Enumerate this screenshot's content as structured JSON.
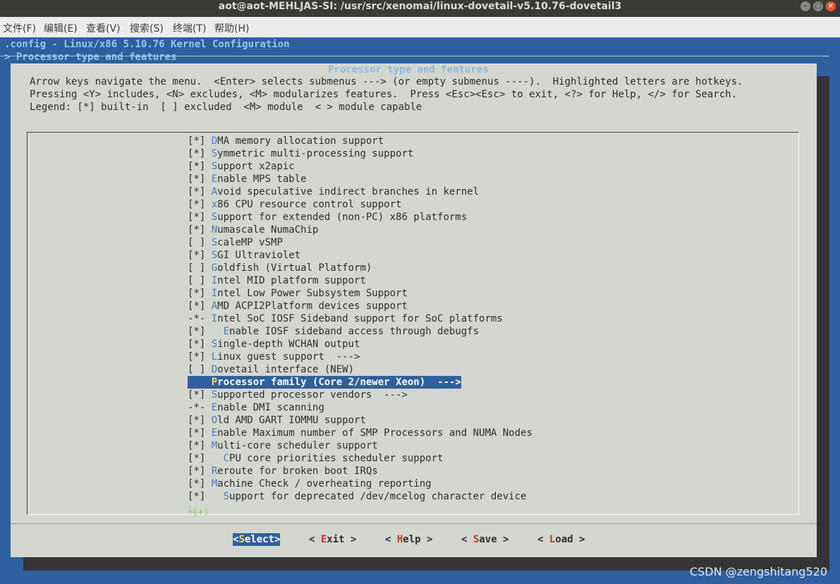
{
  "window": {
    "title": "aot@aot-MEHLJAS-SI: /usr/src/xenomai/linux-dovetail-v5.10.76-dovetail3",
    "buttons": [
      "–",
      "□",
      "×"
    ]
  },
  "menubar": [
    "文件(F)",
    "编辑(E)",
    "查看(V)",
    "搜索(S)",
    "终端(T)",
    "帮助(H)"
  ],
  "header": {
    "config_line": ".config - Linux/x86 5.10.76 Kernel Configuration",
    "breadcrumb": "> Processor type and features"
  },
  "dialog": {
    "title": "Processor type and features",
    "help_lines": [
      "Arrow keys navigate the menu.  <Enter> selects submenus ---> (or empty submenus ----).  Highlighted letters are hotkeys.",
      "Pressing <Y> includes, <N> excludes, <M> modularizes features.  Press <Esc><Esc> to exit, <?> for Help, </> for Search.",
      "Legend: [*] built-in  [ ] excluded  <M> module  < > module capable"
    ]
  },
  "items": [
    {
      "state": "[*]",
      "indent": "",
      "hotkey": "D",
      "rest": "MA memory allocation support"
    },
    {
      "state": "[*]",
      "indent": "",
      "hotkey": "S",
      "rest": "ymmetric multi-processing support"
    },
    {
      "state": "[*]",
      "indent": "",
      "hotkey": "S",
      "rest": "upport x2apic"
    },
    {
      "state": "[*]",
      "indent": "",
      "hotkey": "E",
      "rest": "nable MPS table"
    },
    {
      "state": "[*]",
      "indent": "",
      "hotkey": "A",
      "rest": "void speculative indirect branches in kernel"
    },
    {
      "state": "[*]",
      "indent": "",
      "hotkey": "x",
      "rest": "86 CPU resource control support"
    },
    {
      "state": "[*]",
      "indent": "",
      "hotkey": "S",
      "rest": "upport for extended (non-PC) x86 platforms"
    },
    {
      "state": "[*]",
      "indent": "",
      "hotkey": "N",
      "rest": "umascale NumaChip"
    },
    {
      "state": "[ ]",
      "indent": "",
      "hotkey": "S",
      "rest": "caleMP vSMP"
    },
    {
      "state": "[*]",
      "indent": "",
      "hotkey": "S",
      "rest": "GI Ultraviolet"
    },
    {
      "state": "[ ]",
      "indent": "",
      "hotkey": "G",
      "rest": "oldfish (Virtual Platform)"
    },
    {
      "state": "[ ]",
      "indent": "",
      "hotkey": "I",
      "rest": "ntel MID platform support"
    },
    {
      "state": "[*]",
      "indent": "",
      "hotkey": "I",
      "rest": "ntel Low Power Subsystem Support"
    },
    {
      "state": "[*]",
      "indent": "",
      "hotkey": "A",
      "rest": "MD ACPI2Platform devices support"
    },
    {
      "state": "-*-",
      "indent": "",
      "hotkey": "I",
      "rest": "ntel SoC IOSF Sideband support for SoC platforms"
    },
    {
      "state": "[*]",
      "indent": "  ",
      "hotkey": "E",
      "rest": "nable IOSF sideband access through debugfs"
    },
    {
      "state": "[*]",
      "indent": "",
      "hotkey": "S",
      "rest": "ingle-depth WCHAN output"
    },
    {
      "state": "[*]",
      "indent": "",
      "hotkey": "L",
      "rest": "inux guest support  --->"
    },
    {
      "state": "[ ]",
      "indent": "",
      "hotkey": "D",
      "rest": "ovetail interface (NEW)"
    },
    {
      "state": "   ",
      "indent": "",
      "hotkey": "P",
      "rest": "rocessor family (Core 2/newer Xeon)  --->",
      "selected": true
    },
    {
      "state": "[*]",
      "indent": "",
      "hotkey": "S",
      "rest": "upported processor vendors  --->"
    },
    {
      "state": "-*-",
      "indent": "",
      "hotkey": "E",
      "rest": "nable DMI scanning"
    },
    {
      "state": "[*]",
      "indent": "",
      "hotkey": "O",
      "rest": "ld AMD GART IOMMU support"
    },
    {
      "state": "[*]",
      "indent": "",
      "hotkey": "E",
      "rest": "nable Maximum number of SMP Processors and NUMA Nodes"
    },
    {
      "state": "[*]",
      "indent": "",
      "hotkey": "M",
      "rest": "ulti-core scheduler support"
    },
    {
      "state": "[*]",
      "indent": "  ",
      "hotkey": "C",
      "rest": "PU core priorities scheduler support"
    },
    {
      "state": "[*]",
      "indent": "",
      "hotkey": "R",
      "rest": "eroute for broken boot IRQs"
    },
    {
      "state": "[*]",
      "indent": "",
      "hotkey": "M",
      "rest": "achine Check / overheating reporting"
    },
    {
      "state": "[*]",
      "indent": "  ",
      "hotkey": "S",
      "rest": "upport for deprecated /dev/mcelog character device"
    }
  ],
  "more_indicator": "└(+)",
  "buttons": [
    {
      "pre": "<",
      "hotkey": "S",
      "rest": "elect>",
      "selected": true
    },
    {
      "pre": "< ",
      "hotkey": "E",
      "rest": "xit >"
    },
    {
      "pre": "< ",
      "hotkey": "H",
      "rest": "elp >"
    },
    {
      "pre": "< ",
      "hotkey": "S",
      "rest": "ave >"
    },
    {
      "pre": "< ",
      "hotkey": "L",
      "rest": "oad >"
    }
  ],
  "watermark": "CSDN @zengshitang520"
}
